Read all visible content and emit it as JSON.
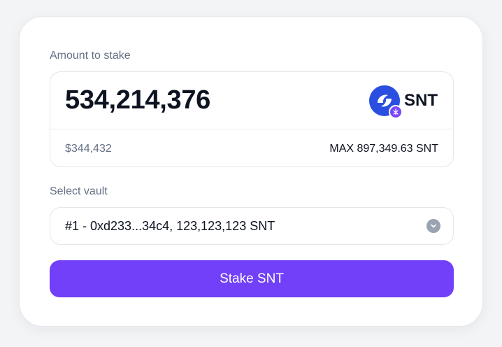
{
  "amount_section": {
    "label": "Amount to stake",
    "value": "534,214,376",
    "usd_value": "$344,432",
    "max_text": "MAX 897,349.63 SNT",
    "token": {
      "symbol": "SNT",
      "logo_icon": "snt-token-icon",
      "badge_icon": "network-badge-icon",
      "logo_color": "#2a4fe0",
      "badge_color": "#7a45ff"
    }
  },
  "vault_section": {
    "label": "Select vault",
    "selected": "#1 - 0xd233...34c4, 123,123,123 SNT"
  },
  "action": {
    "stake_label": "Stake SNT",
    "accent_color": "#7140f8"
  }
}
